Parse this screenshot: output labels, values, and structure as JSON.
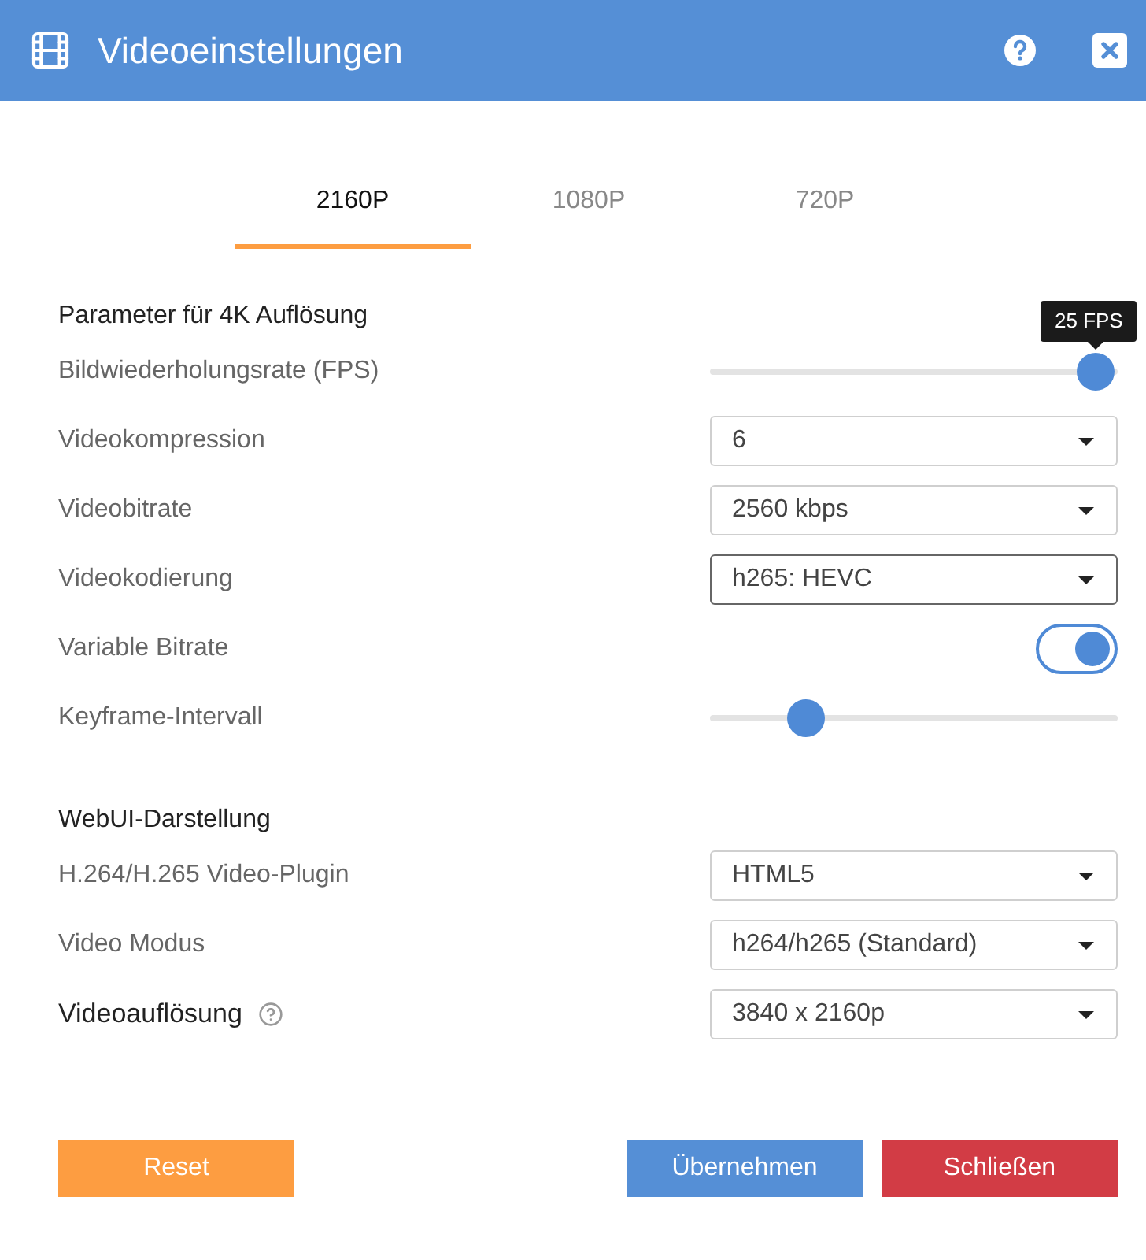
{
  "window": {
    "title": "Videoeinstellungen"
  },
  "tabs": [
    {
      "label": "2160P",
      "selected": true
    },
    {
      "label": "1080P",
      "selected": false
    },
    {
      "label": "720P",
      "selected": false
    }
  ],
  "sections": [
    {
      "heading": "Parameter für 4K Auflösung",
      "rows": [
        {
          "kind": "slider",
          "label": "Bildwiederholungsrate (FPS)",
          "level": 1.0,
          "tooltip": "25 FPS"
        },
        {
          "kind": "select",
          "label": "Videokompression",
          "value": "6",
          "focused": false
        },
        {
          "kind": "select",
          "label": "Videobitrate",
          "value": "2560 kbps",
          "focused": false
        },
        {
          "kind": "select",
          "label": "Videokodierung",
          "value": "h265: HEVC",
          "focused": true
        },
        {
          "kind": "toggle",
          "label": "Variable Bitrate",
          "on": true
        },
        {
          "kind": "slider",
          "label": "Keyframe-Intervall",
          "level": 0.21
        }
      ]
    },
    {
      "heading": "WebUI-Darstellung",
      "rows": [
        {
          "kind": "select",
          "label": "H.264/H.265 Video-Plugin",
          "value": "HTML5",
          "focused": false
        },
        {
          "kind": "select",
          "label": "Video Modus",
          "value": "h264/h265 (Standard)",
          "focused": false
        },
        {
          "kind": "select",
          "label": "Videoauflösung",
          "value": "3840 x 2160p",
          "focused": false,
          "emphasized": true,
          "help": true
        }
      ]
    }
  ],
  "buttons": [
    {
      "kind": "reset",
      "label": "Reset"
    },
    {
      "kind": "apply",
      "label": "Übernehmen"
    },
    {
      "kind": "close",
      "label": "Schließen"
    }
  ]
}
